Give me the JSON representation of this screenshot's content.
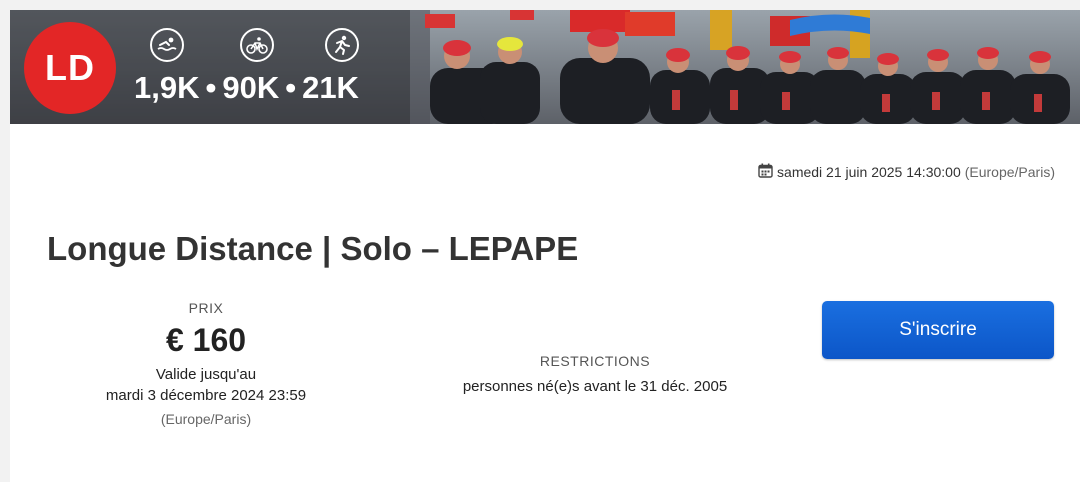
{
  "banner": {
    "badge_text": "LD",
    "badge_color": "#e32626",
    "icons": [
      "swim-icon",
      "bike-icon",
      "run-icon"
    ],
    "distances": [
      "1,9K",
      "90K",
      "21K"
    ],
    "separator": "•"
  },
  "event": {
    "date": "samedi 21 juin 2025 14:30:00",
    "date_timezone": "(Europe/Paris)",
    "title": "Longue Distance | Solo – LEPAPE"
  },
  "price": {
    "label": "PRIX",
    "value": "€ 160",
    "valid_label": "Valide jusqu'au",
    "valid_until": "mardi 3 décembre 2024 23:59",
    "timezone": "(Europe/Paris)"
  },
  "restrictions": {
    "label": "RESTRICTIONS",
    "value": "personnes né(e)s avant le 31 déc. 2005"
  },
  "actions": {
    "register_label": "S'inscrire",
    "register_color": "#0c56c8"
  }
}
